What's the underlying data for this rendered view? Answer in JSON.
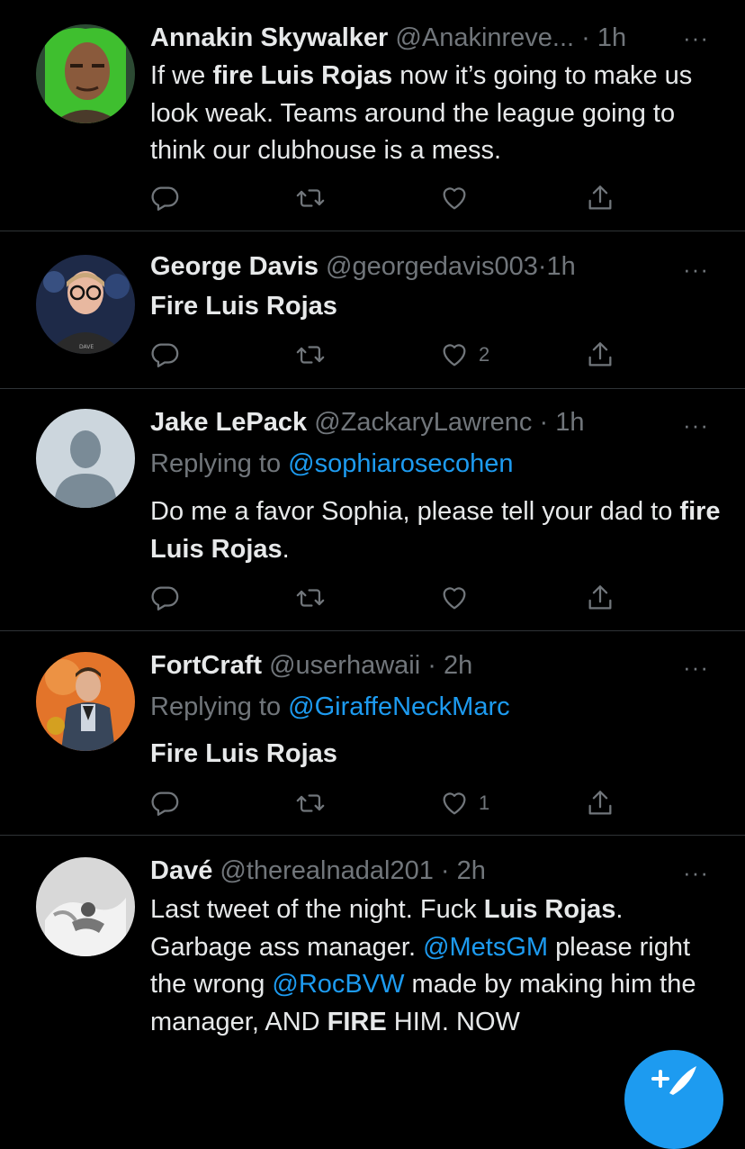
{
  "tweets": [
    {
      "name": "Annakin Skywalker",
      "handle": "@Anakinreve...",
      "time": "1h",
      "more": "···",
      "body_html": "If we <b>fire Luis Rojas</b> now it’s going to make us look weak. Teams around the league going to think our clubhouse is a mess.",
      "likes": ""
    },
    {
      "name": "George Davis",
      "handle": "@georgedavis003",
      "time": "1h",
      "more": "···",
      "body_html": "<b>Fire Luis Rojas</b>",
      "likes": "2"
    },
    {
      "name": "Jake LePack",
      "handle": "@ZackaryLawrenc",
      "time": "1h",
      "more": "···",
      "replying_prefix": "Replying to",
      "replying_to": "@sophiarosecohen",
      "body_html": "Do me a favor Sophia, please tell your dad to <b>fire Luis Rojas</b>.",
      "likes": ""
    },
    {
      "name": "FortCraft",
      "handle": "@userhawaii",
      "time": "2h",
      "more": "···",
      "replying_prefix": "Replying to",
      "replying_to": "@GiraffeNeckMarc",
      "body_html": "<b>Fire Luis Rojas</b>",
      "likes": "1"
    },
    {
      "name": "Davé",
      "handle": "@therealnadal201",
      "time": "2h",
      "more": "···",
      "body_html": "Last tweet of the night. Fuck <b>Luis Rojas</b>. Garbage ass manager. <span class=\"mention\">@MetsGM</span> please right the wrong <span class=\"mention\">@RocBVW</span> made by making him the manager, AND <b>FIRE</b> HIM. NOW",
      "likes": ""
    }
  ],
  "avatar_text": {
    "george_shirt": "DAVE"
  },
  "colors": {
    "accent": "#1d9bf0",
    "muted": "#71767b",
    "text": "#e7e9ea",
    "divider": "#2f3336",
    "background": "#000000"
  },
  "icons": [
    "reply-icon",
    "retweet-icon",
    "like-icon",
    "share-icon",
    "more-icon",
    "compose-icon"
  ]
}
